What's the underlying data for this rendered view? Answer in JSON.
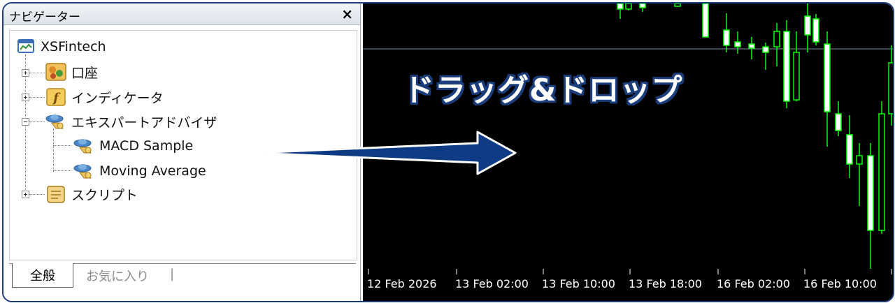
{
  "navigator": {
    "title": "ナビゲーター",
    "close": "×",
    "root": "XSFintech",
    "items": [
      {
        "label": "口座"
      },
      {
        "label": "インディケータ"
      },
      {
        "label": "エキスパートアドバイザ"
      },
      {
        "label": "スクリプト"
      }
    ],
    "experts": [
      {
        "label": "MACD Sample"
      },
      {
        "label": "Moving Average"
      }
    ],
    "tabs": {
      "active": "全般",
      "inactive": "お気に入り",
      "separator": "|"
    }
  },
  "overlay": {
    "drag_text": "ドラッグ&ドロップ"
  },
  "chart": {
    "time_labels": [
      "12 Feb 2026",
      "13 Feb 02:00",
      "13 Feb 10:00",
      "13 Feb 18:00",
      "16 Feb 02:00",
      "16 Feb 10:00"
    ],
    "colors": {
      "background": "#000000",
      "candle": "#00ff00",
      "up_fill": "#ffffff",
      "grid": "#7f8fa6"
    }
  },
  "icons": {
    "root": "platform-icon",
    "account": "account-icon",
    "indicator": "indicator-icon",
    "expert": "expert-icon",
    "script": "script-icon",
    "arrow": "arrow-right-icon"
  }
}
